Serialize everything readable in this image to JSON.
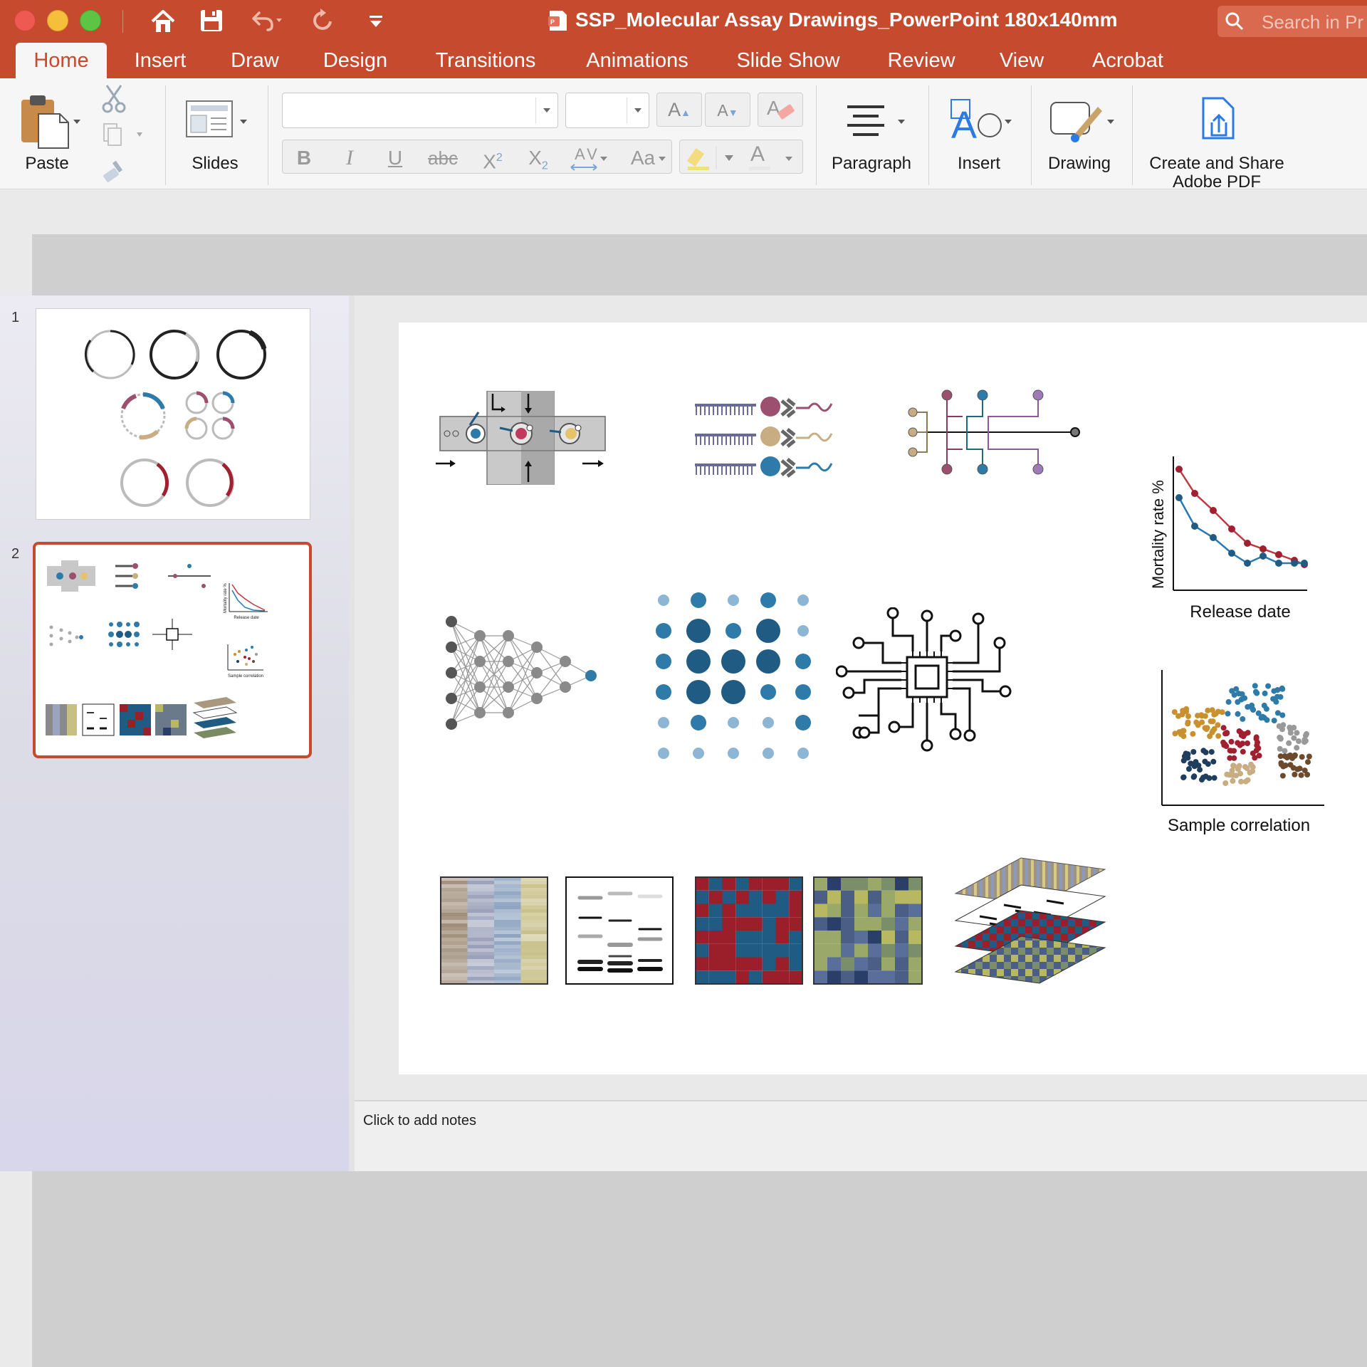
{
  "window": {
    "title": "SSP_Molecular Assay Drawings_PowerPoint 180x140mm",
    "search_placeholder": "Search in Pr"
  },
  "tabs": [
    "Home",
    "Insert",
    "Draw",
    "Design",
    "Transitions",
    "Animations",
    "Slide Show",
    "Review",
    "View",
    "Acrobat"
  ],
  "active_tab": "Home",
  "ribbon": {
    "paste": "Paste",
    "slides": "Slides",
    "font_name": "",
    "font_size": "",
    "grow_font": "A",
    "shrink_font": "A",
    "bold": "B",
    "italic": "I",
    "underline": "U",
    "strikethrough": "abc",
    "superscript_base": "X",
    "superscript_mark": "2",
    "subscript_base": "X",
    "subscript_mark": "2",
    "char_spacing": "AV",
    "change_case": "Aa",
    "font_color": "A",
    "paragraph": "Paragraph",
    "insert": "Insert",
    "drawing": "Drawing",
    "create_pdf_line1": "Create and Share",
    "create_pdf_line2": "Adobe PDF"
  },
  "thumbnails": {
    "slide1_number": "1",
    "slide2_number": "2",
    "selected_slide": "2",
    "slide2_chart_ylabel": "Mortality rate %",
    "slide2_chart_xlabel": "Release date",
    "slide2_scatter_label": "Sample correlation"
  },
  "slide": {
    "line_chart": {
      "ylabel": "Mortality rate %",
      "xlabel": "Release date"
    },
    "scatter_label": "Sample correlation"
  },
  "notes_placeholder": "Click to add notes",
  "colors": {
    "accent": "#c64a2d",
    "maroon": "#9c4f6e",
    "tan": "#c8ac82",
    "blue": "#2e7aa8",
    "navy": "#1f5b83",
    "red_series": "#c0363f",
    "blue_series": "#2a78b4"
  }
}
